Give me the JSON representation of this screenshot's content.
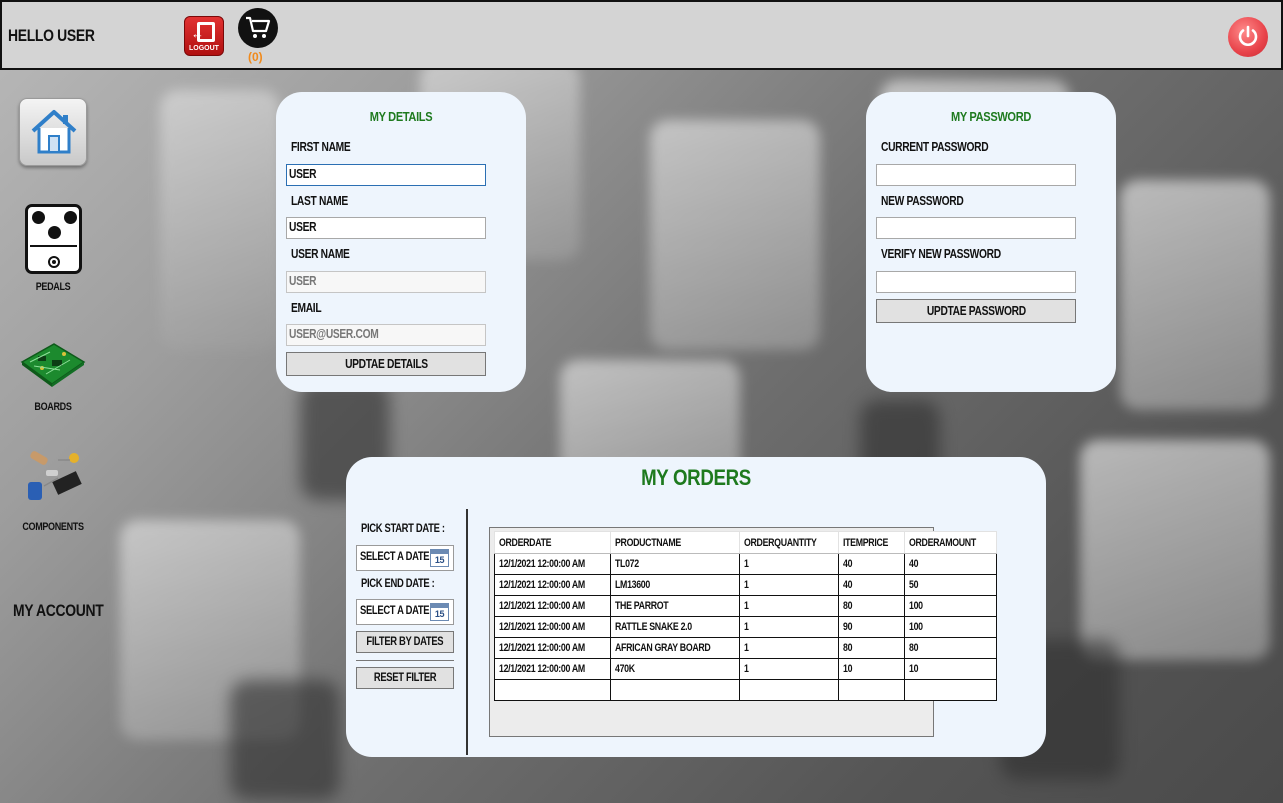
{
  "header": {
    "greeting": "HELLO USER",
    "logout_label": "LOGOUT",
    "cart_count": "(0)"
  },
  "sidebar": {
    "items": [
      {
        "label": "",
        "icon": "home-icon"
      },
      {
        "label": "PEDALS",
        "icon": "pedal-icon"
      },
      {
        "label": "BOARDS",
        "icon": "circuit-board-icon"
      },
      {
        "label": "COMPONENTS",
        "icon": "components-icon"
      }
    ],
    "my_account": "MY ACCOUNT"
  },
  "details": {
    "title": "MY DETAILS",
    "first_name_label": "FIRST NAME",
    "first_name_value": "USER",
    "last_name_label": "LAST NAME",
    "last_name_value": "USER",
    "user_name_label": "USER NAME",
    "user_name_value": "USER",
    "email_label": "EMAIL",
    "email_value": "USER@USER.COM",
    "update_button": "UPDTAE DETAILS"
  },
  "password": {
    "title": "MY PASSWORD",
    "current_label": "CURRENT PASSWORD",
    "new_label": "NEW PASSWORD",
    "verify_label": "VERIFY NEW PASSWORD",
    "update_button": "UPDTAE PASSWORD"
  },
  "orders": {
    "title": "MY ORDERS",
    "start_label": "PICK START DATE :",
    "start_value": "SELECT A DATE",
    "end_label": "PICK END DATE :",
    "end_value": "SELECT A DATE",
    "calendar_day": "15",
    "filter_button": "FILTER BY DATES",
    "reset_button": "RESET FILTER",
    "columns": [
      "ORDERDATE",
      "PRODUCTNAME",
      "ORDERQUANTITY",
      "ITEMPRICE",
      "ORDERAMOUNT"
    ],
    "rows": [
      [
        "12/1/2021 12:00:00 AM",
        "TL072",
        "1",
        "40",
        "40"
      ],
      [
        "12/1/2021 12:00:00 AM",
        "LM13600",
        "1",
        "40",
        "50"
      ],
      [
        "12/1/2021 12:00:00 AM",
        "THE PARROT",
        "1",
        "80",
        "100"
      ],
      [
        "12/1/2021 12:00:00 AM",
        "RATTLE SNAKE 2.0",
        "1",
        "90",
        "100"
      ],
      [
        "12/1/2021 12:00:00 AM",
        "AFRICAN GRAY BOARD",
        "1",
        "80",
        "80"
      ],
      [
        "12/1/2021 12:00:00 AM",
        "470K",
        "1",
        "10",
        "10"
      ]
    ]
  },
  "colors": {
    "title_green": "#1e7a1e",
    "logout_red": "#d42020",
    "power_red": "#e8434a",
    "cart_count_orange": "#f08a1c",
    "panel_bg": "#eef5fd"
  }
}
